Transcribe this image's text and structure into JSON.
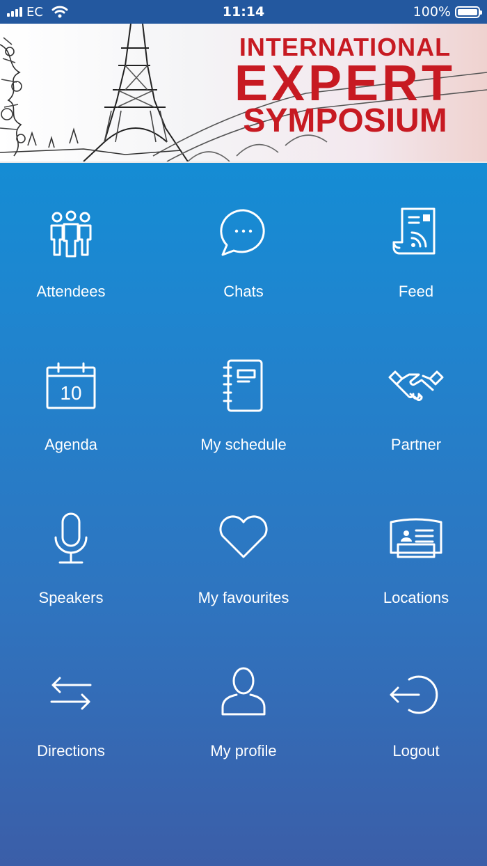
{
  "status_bar": {
    "carrier": "EC",
    "time": "11:14",
    "battery": "100%"
  },
  "banner": {
    "line1": "INTERNATIONAL",
    "line2": "EXPERT",
    "line3": "SYMPOSIUM"
  },
  "menu": [
    {
      "label": "Attendees",
      "icon": "attendees-icon"
    },
    {
      "label": "Chats",
      "icon": "chat-bubble-icon"
    },
    {
      "label": "Feed",
      "icon": "news-feed-icon"
    },
    {
      "label": "Agenda",
      "icon": "calendar-icon"
    },
    {
      "label": "My schedule",
      "icon": "notebook-icon"
    },
    {
      "label": "Partner",
      "icon": "handshake-icon"
    },
    {
      "label": "Speakers",
      "icon": "microphone-icon"
    },
    {
      "label": "My favourites",
      "icon": "heart-icon"
    },
    {
      "label": "Locations",
      "icon": "booth-icon"
    },
    {
      "label": "Directions",
      "icon": "arrows-icon"
    },
    {
      "label": "My profile",
      "icon": "profile-icon"
    },
    {
      "label": "Logout",
      "icon": "logout-icon"
    }
  ],
  "calendar_day": "10",
  "colors": {
    "status_bar": "#23589f",
    "gradient_top": "#0a93d8",
    "gradient_bottom": "#3b5ea8",
    "brand_red": "#c71a22"
  }
}
